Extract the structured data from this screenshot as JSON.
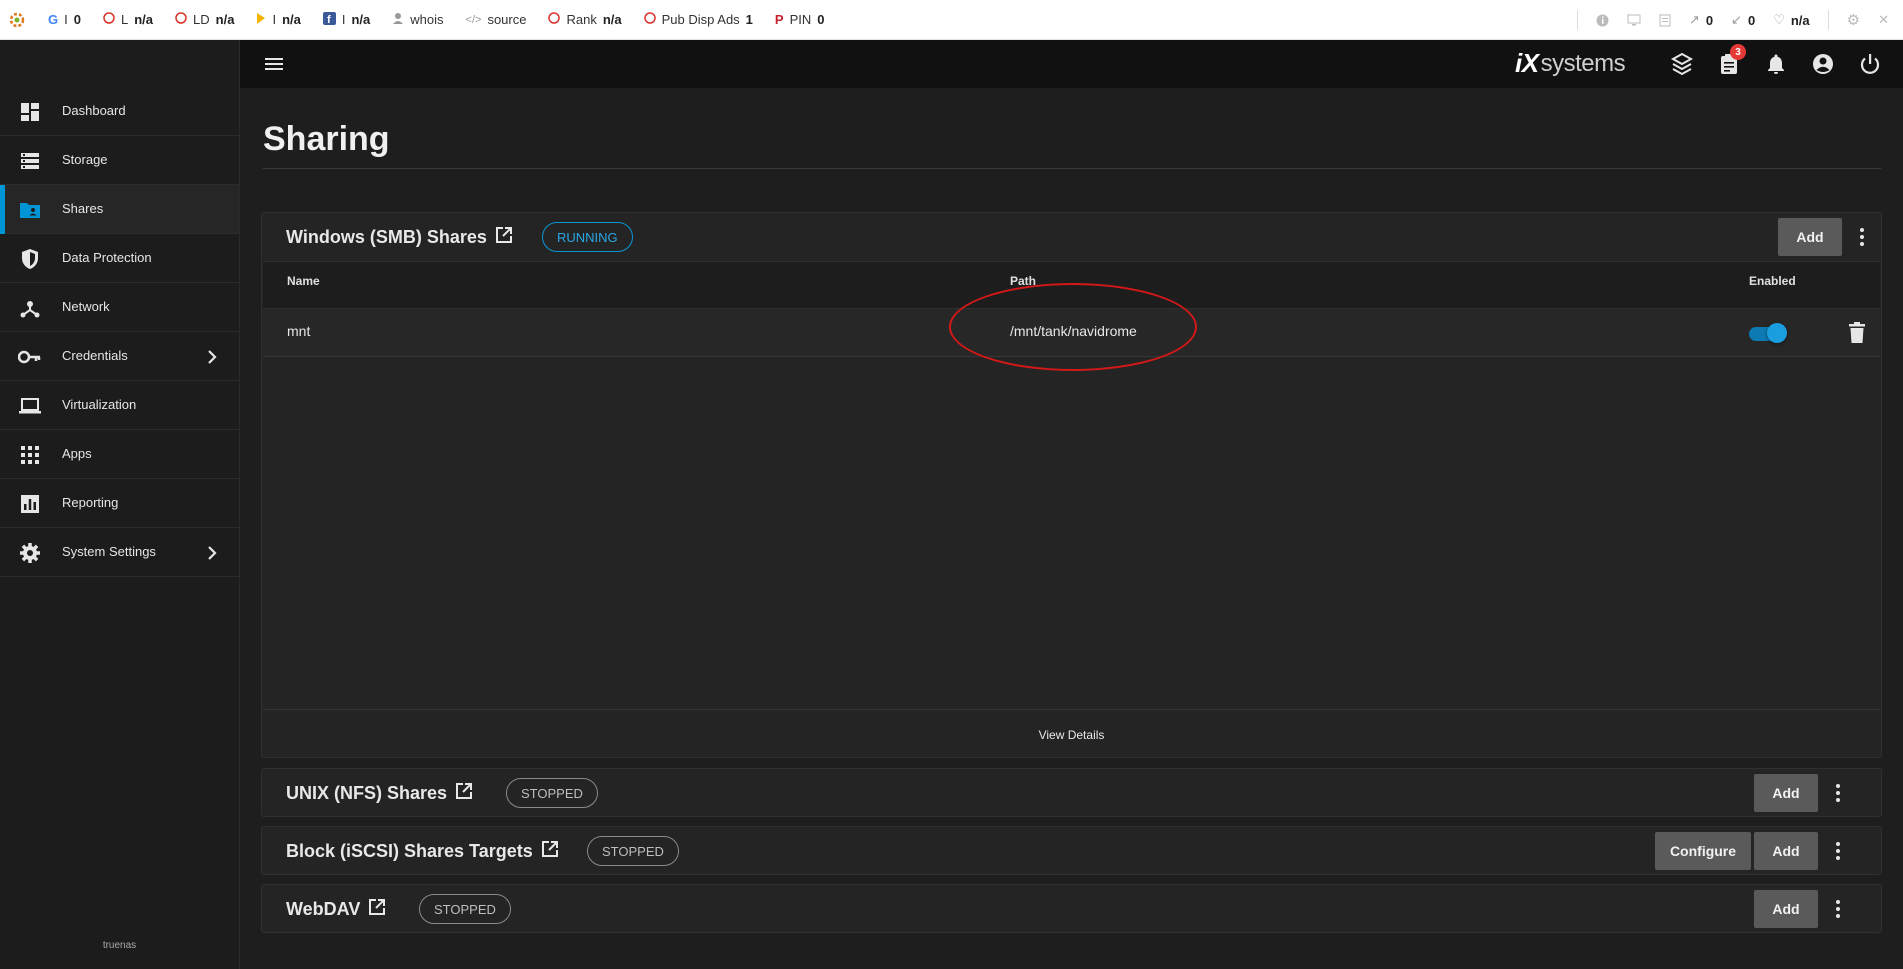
{
  "seo_bar": {
    "google": {
      "label": "I",
      "value": "0"
    },
    "links": {
      "label": "L",
      "value": "n/a"
    },
    "ld": {
      "label": "LD",
      "value": "n/a"
    },
    "bing": {
      "label": "I",
      "value": "n/a"
    },
    "facebook": {
      "label": "I",
      "value": "n/a"
    },
    "whois": "whois",
    "source": "source",
    "rank": {
      "label": "Rank",
      "value": "n/a"
    },
    "pub_ads": {
      "label": "Pub Disp Ads",
      "value": "1"
    },
    "pin": {
      "label": "PIN",
      "value": "0"
    },
    "right": {
      "ext_links": "0",
      "int_links": "0",
      "health": "n/a"
    }
  },
  "header": {
    "brand_ix": "iX",
    "brand_systems": "systems",
    "tasks_badge": "3"
  },
  "sidebar": {
    "items": [
      {
        "label": "Dashboard",
        "icon": "dashboard-icon"
      },
      {
        "label": "Storage",
        "icon": "storage-icon"
      },
      {
        "label": "Shares",
        "icon": "folder-shared-icon",
        "active": true
      },
      {
        "label": "Data Protection",
        "icon": "shield-icon"
      },
      {
        "label": "Network",
        "icon": "network-icon"
      },
      {
        "label": "Credentials",
        "icon": "key-icon",
        "expandable": true
      },
      {
        "label": "Virtualization",
        "icon": "laptop-icon"
      },
      {
        "label": "Apps",
        "icon": "apps-grid-icon"
      },
      {
        "label": "Reporting",
        "icon": "chart-icon"
      },
      {
        "label": "System Settings",
        "icon": "gear-icon",
        "expandable": true
      }
    ],
    "hostname": "truenas"
  },
  "page": {
    "title": "Sharing"
  },
  "smb": {
    "title": "Windows (SMB) Shares",
    "status": "RUNNING",
    "add_label": "Add",
    "columns": {
      "name": "Name",
      "path": "Path",
      "enabled": "Enabled"
    },
    "rows": [
      {
        "name": "mnt",
        "path": "/mnt/tank/navidrome",
        "enabled": true
      }
    ],
    "view_details": "View Details"
  },
  "nfs": {
    "title": "UNIX (NFS) Shares",
    "status": "STOPPED",
    "add_label": "Add"
  },
  "iscsi": {
    "title": "Block (iSCSI) Shares Targets",
    "status": "STOPPED",
    "configure_label": "Configure",
    "add_label": "Add"
  },
  "webdav": {
    "title": "WebDAV",
    "status": "STOPPED",
    "add_label": "Add"
  },
  "colors": {
    "accent": "#0095d5",
    "annotation": "#d41818",
    "background": "#1e1e1e"
  }
}
